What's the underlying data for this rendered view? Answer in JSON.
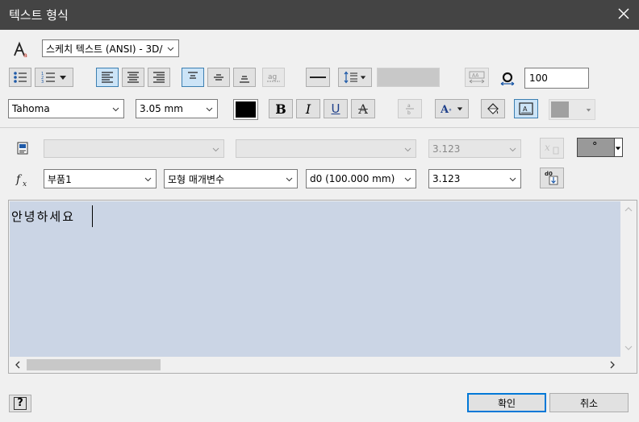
{
  "dialog": {
    "title": "텍스트 형식"
  },
  "row1": {
    "text_style": "스케치 텍스트 (ANSI) - 3D/",
    "stretch_value": "100"
  },
  "row3": {
    "font": "Tahoma",
    "size": "3.05 mm",
    "color": "#000000",
    "bold": "B",
    "italic": "I",
    "underline": "U",
    "strike": "A"
  },
  "row4": {
    "precision": "3.123",
    "symbol": "°"
  },
  "row5": {
    "component": "부품1",
    "parameter_type": "모형 매개변수",
    "parameter": "d0 (100.000 mm)",
    "precision": "3.123"
  },
  "editor": {
    "text": "안녕하세요"
  },
  "buttons": {
    "ok": "확인",
    "cancel": "취소",
    "help": "?"
  }
}
